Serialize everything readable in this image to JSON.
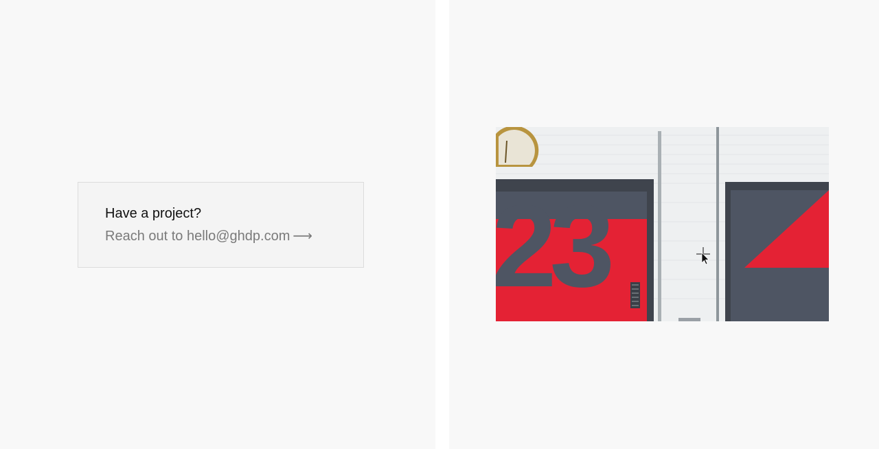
{
  "cta": {
    "heading": "Have a project?",
    "prefix": "Reach out to ",
    "email": "hello@ghdp.com",
    "arrow": "⟶"
  },
  "photo": {
    "description_icon": "photo-image",
    "sign_number": "23",
    "colors": {
      "red": "#e42234",
      "door_gray": "#4e5563",
      "frame_gray": "#3f444d",
      "wall_white": "#eef0f1"
    }
  },
  "cursor": {
    "icon": "crosshair-arrow-cursor"
  }
}
